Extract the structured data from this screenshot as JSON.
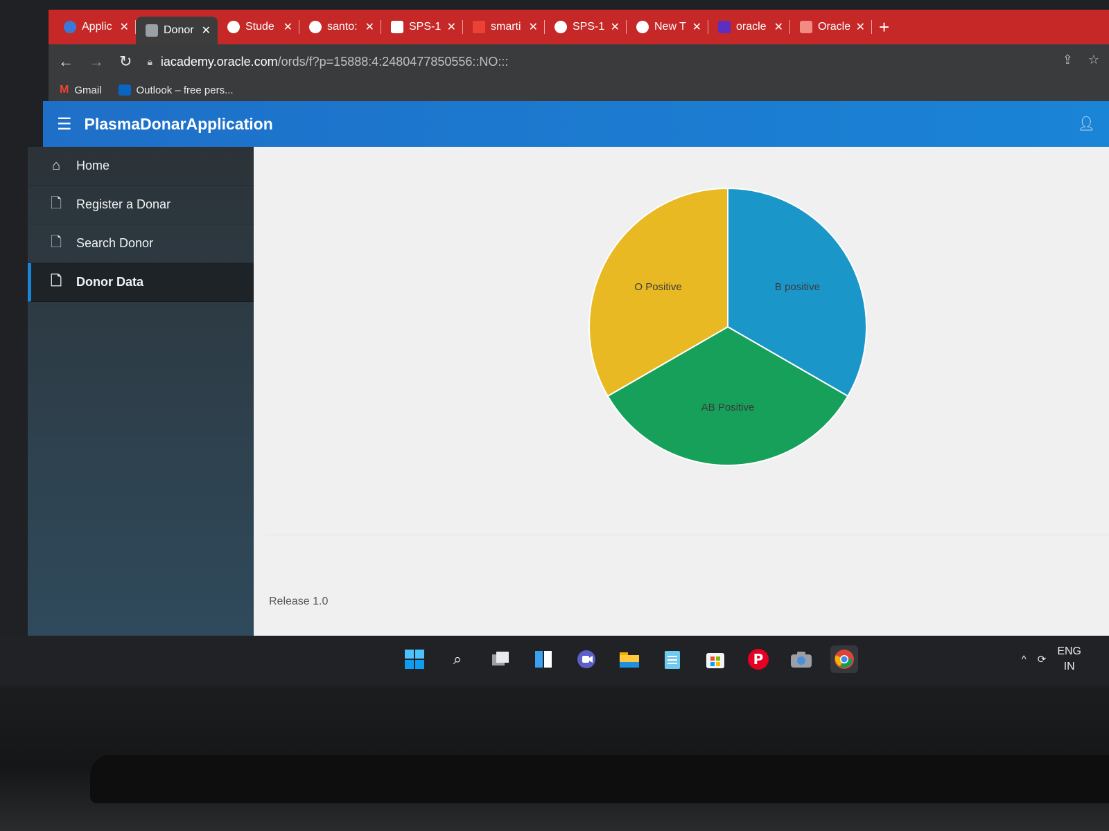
{
  "browser": {
    "tabs": [
      {
        "label": "Applic",
        "icon": "app-x-icon",
        "color": "#3a79d8"
      },
      {
        "label": "Donor",
        "icon": "page-icon",
        "color": "#9aa0a6",
        "active": true
      },
      {
        "label": "Stude",
        "icon": "globe-icon",
        "color": "#ffffff"
      },
      {
        "label": "santo:",
        "icon": "github-icon",
        "color": "#ffffff"
      },
      {
        "label": "SPS-1",
        "icon": "doc-icon",
        "color": "#ffffff"
      },
      {
        "label": "smarti",
        "icon": "gmail-icon",
        "color": "#ea4335"
      },
      {
        "label": "SPS-1",
        "icon": "github-icon",
        "color": "#ffffff"
      },
      {
        "label": "New T",
        "icon": "globe-icon",
        "color": "#ffffff"
      },
      {
        "label": "oracle",
        "icon": "yahoo-icon",
        "color": "#5c2ec1"
      },
      {
        "label": "Oracle",
        "icon": "oracle-icon",
        "color": "#f28b82"
      }
    ],
    "url_host": "iacademy.oracle.com",
    "url_path": "/ords/f?p=15888:4:2480477850556::NO:::",
    "bookmarks": [
      "Gmail",
      "Outlook – free pers..."
    ]
  },
  "app": {
    "title": "PlasmaDonarApplication",
    "nav": [
      {
        "label": "Home",
        "icon": "home-icon"
      },
      {
        "label": "Register a Donar",
        "icon": "page-icon"
      },
      {
        "label": "Search Donor",
        "icon": "page-icon"
      },
      {
        "label": "Donor Data",
        "icon": "page-icon",
        "current": true
      }
    ],
    "footer": "Release 1.0"
  },
  "chart_data": {
    "type": "pie",
    "categories": [
      "B positive",
      "AB Positive",
      "O Positive"
    ],
    "values": [
      1,
      1,
      1
    ],
    "colors": [
      "#1b96c8",
      "#16a05a",
      "#e8b923"
    ]
  },
  "taskbar": {
    "icons": [
      "windows-start-icon",
      "search-icon",
      "task-view-icon",
      "widgets-icon",
      "teams-icon",
      "file-explorer-icon",
      "notepad-icon",
      "store-icon",
      "pinterest-icon",
      "camera-icon",
      "chrome-icon"
    ],
    "lang_line1": "ENG",
    "lang_line2": "IN"
  }
}
